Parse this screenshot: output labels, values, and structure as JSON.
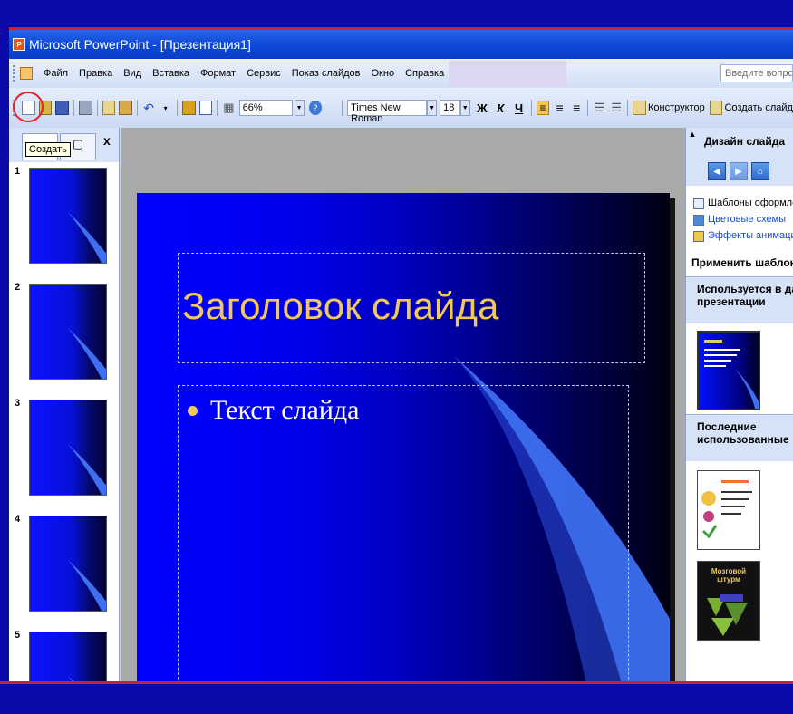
{
  "window": {
    "title": "Microsoft PowerPoint - [Презентация1]"
  },
  "menu": {
    "items": [
      "Файл",
      "Правка",
      "Вид",
      "Вставка",
      "Формат",
      "Сервис",
      "Показ слайдов",
      "Окно",
      "Справка"
    ],
    "help_placeholder": "Введите вопрос"
  },
  "toolbar": {
    "zoom": "66%",
    "font": "Times New Roman",
    "size": "18",
    "bold": "Ж",
    "italic": "К",
    "underline": "Ч",
    "designer_label": "Конструктор",
    "create_slide_label": "Создать слайд"
  },
  "left_pane": {
    "tooltip": "Создать",
    "close": "x",
    "slides": [
      "1",
      "2",
      "3",
      "4",
      "5"
    ]
  },
  "slide": {
    "title": "Заголовок слайда",
    "body": "Текст слайда"
  },
  "right_pane": {
    "header": "Дизайн слайда",
    "links": [
      "Шаблоны оформления",
      "Цветовые схемы",
      "Эффекты анимации"
    ],
    "apply_label": "Применить шаблон",
    "used_header_1": "Используется в данной",
    "used_header_2": "презентации",
    "recent_header_1": "Последние",
    "recent_header_2": "использованные",
    "thumb_label": "Мозговой штурм"
  },
  "colors": {
    "accent": "#0c48d8",
    "highlight": "#e0222a",
    "slide_title": "#f0c860"
  }
}
